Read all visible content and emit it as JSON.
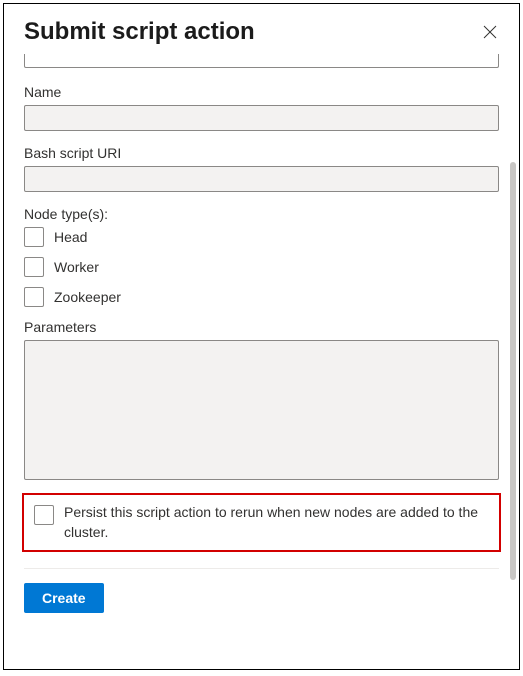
{
  "header": {
    "title": "Submit script action"
  },
  "form": {
    "name_label": "Name",
    "name_value": "",
    "uri_label": "Bash script URI",
    "uri_value": "",
    "node_types_label": "Node type(s):",
    "node_types": [
      {
        "label": "Head",
        "checked": false
      },
      {
        "label": "Worker",
        "checked": false
      },
      {
        "label": "Zookeeper",
        "checked": false
      }
    ],
    "parameters_label": "Parameters",
    "parameters_value": "",
    "persist_label": "Persist this script action to rerun when new nodes are added to the cluster.",
    "persist_checked": false
  },
  "footer": {
    "create_label": "Create"
  }
}
